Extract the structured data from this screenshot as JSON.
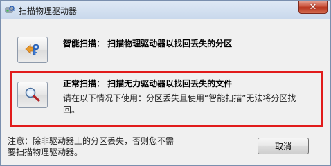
{
  "window": {
    "title": "扫描物理驱动器",
    "close_glyph": "✕",
    "title_icon": "drive-scan-icon"
  },
  "options": [
    {
      "icon": "drive-key-scan-icon",
      "label": "智能扫描： 扫描物理驱动器以找回丢失的分区"
    },
    {
      "icon": "magnifier-icon",
      "label": "正常扫描： 扫描无力驱动器以找回丢失的文件",
      "description": "请在以下情况下使用：分区丢失且使用“智能扫描”无法将分区找回。"
    }
  ],
  "footer": {
    "note": "注意：除非驱动器上的分区丢失，否则您不需要扫描物理驱动器。",
    "cancel_label": "取消"
  },
  "colors": {
    "highlight": "#e11b1b",
    "dialog_background": "#f0f0f0",
    "close_button": "#c9513a"
  }
}
